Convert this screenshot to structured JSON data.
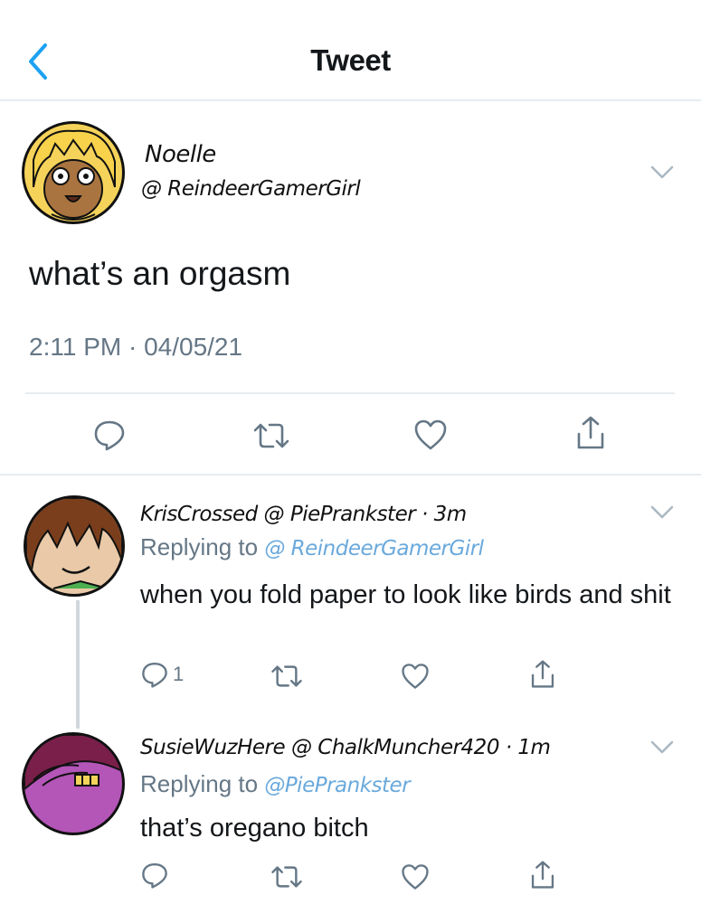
{
  "header": {
    "title": "Tweet",
    "back_icon": "chevron-left-icon"
  },
  "colors": {
    "accent": "#1da1f2",
    "muted": "#657786",
    "divider": "#e6ecf0"
  },
  "main_tweet": {
    "author_name": "Noelle",
    "author_handle": "@ ReindeerGamerGirl",
    "text": "what’s an orgasm",
    "timestamp": "2:11 PM · 04/05/21"
  },
  "replies": [
    {
      "author_name": "KrisCrossed",
      "author_handle": "@ PiePrankster",
      "age": "· 3m",
      "replying_label": "Replying to",
      "replying_handle": "@ ReindeerGamerGirl",
      "text": "when you fold paper to look like birds and shit",
      "reply_count": "1"
    },
    {
      "author_name": "SusieWuzHere",
      "author_handle": "@ ChalkMuncher420",
      "age": "· 1m",
      "replying_label": "Replying to",
      "replying_handle": "@PiePrankster",
      "text": "that’s oregano bitch",
      "reply_count": ""
    }
  ]
}
